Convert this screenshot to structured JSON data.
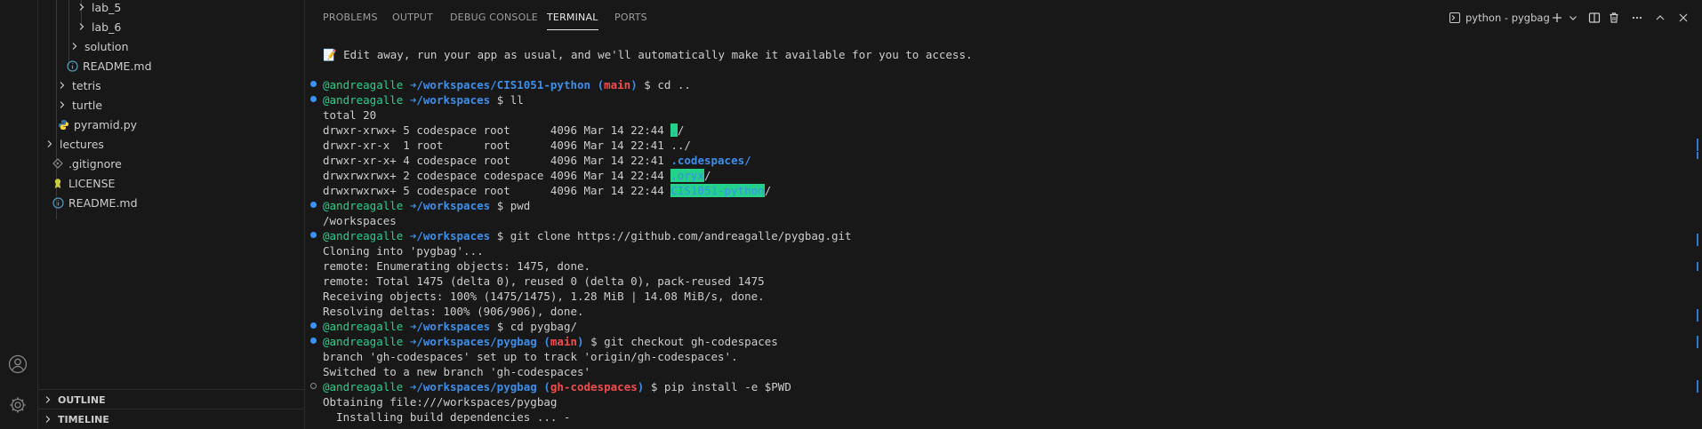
{
  "sidebar": {
    "tree": [
      {
        "label": "lab_5",
        "depth": 3,
        "type": "folder"
      },
      {
        "label": "lab_6",
        "depth": 3,
        "type": "folder"
      },
      {
        "label": "solution",
        "depth": 2,
        "type": "folder"
      },
      {
        "label": "README.md",
        "depth": 2,
        "type": "info-file"
      },
      {
        "label": "tetris",
        "depth": 1,
        "type": "folder"
      },
      {
        "label": "turtle",
        "depth": 1,
        "type": "folder"
      },
      {
        "label": "pyramid.py",
        "depth": 1,
        "type": "python-file"
      },
      {
        "label": "lectures",
        "depth": 0,
        "type": "folder"
      },
      {
        "label": ".gitignore",
        "depth": 0,
        "type": "git-file"
      },
      {
        "label": "LICENSE",
        "depth": 0,
        "type": "license-file"
      },
      {
        "label": "README.md",
        "depth": 0,
        "type": "info-file"
      }
    ],
    "outline_label": "OUTLINE",
    "timeline_label": "TIMELINE"
  },
  "panel": {
    "tabs": [
      "PROBLEMS",
      "OUTPUT",
      "DEBUG CONSOLE",
      "TERMINAL",
      "PORTS"
    ],
    "active_tab": "TERMINAL",
    "terminal_name": "python - pygbag"
  },
  "terminal": {
    "banner": "📝 Edit away, run your app as usual, and we'll automatically make it available for you to access.",
    "user": "@andreagalle",
    "arrow": "➜",
    "lines": {
      "p1_path": "/workspaces/CIS1051-python",
      "p1_branch": "main",
      "p1_cmd": "$ cd ..",
      "p2_path": "/workspaces",
      "p2_cmd": "$ ll",
      "total": "total 20",
      "ls1_pre": "drwxr-xrwx+ 5 codespace root      4096 Mar 14 22:44 ",
      "ls1_name": ".",
      "ls1_post": "/",
      "ls2": "drwxr-xr-x  1 root      root      4096 Mar 14 22:41 ../",
      "ls3_pre": "drwxr-xr-x+ 4 codespace root      4096 Mar 14 22:41 ",
      "ls3_name": ".codespaces/",
      "ls4_pre": "drwxrwxrwx+ 2 codespace codespace 4096 Mar 14 22:44 ",
      "ls4_name": ".oryx",
      "ls4_post": "/",
      "ls5_pre": "drwxrwxrwx+ 5 codespace root      4096 Mar 14 22:44 ",
      "ls5_name": "CIS1051-python",
      "ls5_post": "/",
      "p3_path": "/workspaces",
      "p3_cmd": "$ pwd",
      "pwd_out": "/workspaces",
      "p4_path": "/workspaces",
      "p4_cmd": "$ git clone https://github.com/andreagalle/pygbag.git",
      "clone1": "Cloning into 'pygbag'...",
      "clone2": "remote: Enumerating objects: 1475, done.",
      "clone3": "remote: Total 1475 (delta 0), reused 0 (delta 0), pack-reused 1475",
      "clone4": "Receiving objects: 100% (1475/1475), 1.28 MiB | 14.08 MiB/s, done.",
      "clone5": "Resolving deltas: 100% (906/906), done.",
      "p5_path": "/workspaces",
      "p5_cmd": "$ cd pygbag/",
      "p6_path": "/workspaces/pygbag",
      "p6_branch": "main",
      "p6_cmd": "$ git checkout gh-codespaces",
      "co1": "branch 'gh-codespaces' set up to track 'origin/gh-codespaces'.",
      "co2": "Switched to a new branch 'gh-codespaces'",
      "p7_path": "/workspaces/pygbag",
      "p7_branch": "gh-codespaces",
      "p7_cmd": "$ pip install -e $PWD",
      "pip1": "Obtaining file:///workspaces/pygbag",
      "pip2": "  Installing build dependencies ... -"
    }
  },
  "colors": {
    "bg": "#181818",
    "user_green": "#23d18b",
    "path_blue": "#3b8eea",
    "branch_red": "#f14c4c",
    "dot_blue": "#3794ff"
  }
}
